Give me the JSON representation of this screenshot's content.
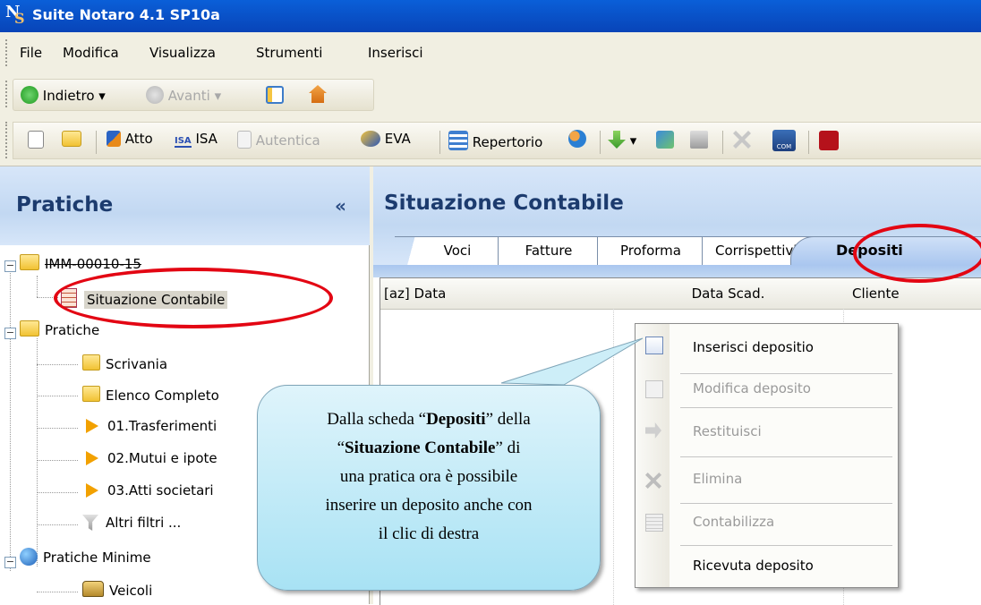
{
  "window": {
    "title": "Suite Notaro 4.1 SP10a",
    "logo_letters": "NS"
  },
  "menu": [
    "File",
    "Modifica",
    "Visualizza",
    "Strumenti",
    "Inserisci"
  ],
  "nav": {
    "back": "Indietro",
    "forward": "Avanti"
  },
  "toolbar": {
    "atto": "Atto",
    "isa": "ISA",
    "autentica": "Autentica",
    "eva": "EVA",
    "repertorio": "Repertorio",
    "isa_badge": "ISA",
    "com_badge": "COM"
  },
  "left_panel": {
    "title": "Pratiche",
    "collapse": "«",
    "tree": {
      "case_id": "IMM-00010-15",
      "situazione": "Situazione Contabile",
      "pratiche": "Pratiche",
      "scrivania": "Scrivania",
      "elenco": "Elenco Completo",
      "f1": "01.Trasferimenti",
      "f2": "02.Mutui e ipote",
      "f3": "03.Atti societari",
      "altri": "Altri filtri ...",
      "minime": "Pratiche Minime",
      "veicoli": "Veicoli"
    }
  },
  "right_panel": {
    "title": "Situazione Contabile",
    "tabs": [
      "Voci",
      "Fatture",
      "Proforma",
      "Corrispettivi",
      "Depositi"
    ],
    "active_tab": "Depositi",
    "columns": [
      "[az] Data",
      "Data Scad.",
      "Cliente"
    ]
  },
  "context_menu": [
    {
      "label": "Inserisci depositio",
      "enabled": true
    },
    {
      "label": "Modifica deposito",
      "enabled": false
    },
    {
      "label": "Restituisci",
      "enabled": false
    },
    {
      "label": "Elimina",
      "enabled": false
    },
    {
      "label": "Contabilizza",
      "enabled": false
    },
    {
      "label": "Ricevuta deposito",
      "enabled": true
    }
  ],
  "callout": {
    "pre": "Dalla scheda “",
    "bold1": "Depositi",
    "mid1": "” della",
    "q": "“",
    "bold2": "Situazione Contabile",
    "mid2": "” di",
    "line3": "una pratica ora è possibile",
    "line4": "inserire un deposito anche con",
    "line5": "il clic di destra"
  },
  "colors": {
    "title_bar": "#0a5fd8",
    "highlight": "#e30613",
    "header_blue": "#c2d8f2",
    "callout": "#a8e2f4"
  }
}
